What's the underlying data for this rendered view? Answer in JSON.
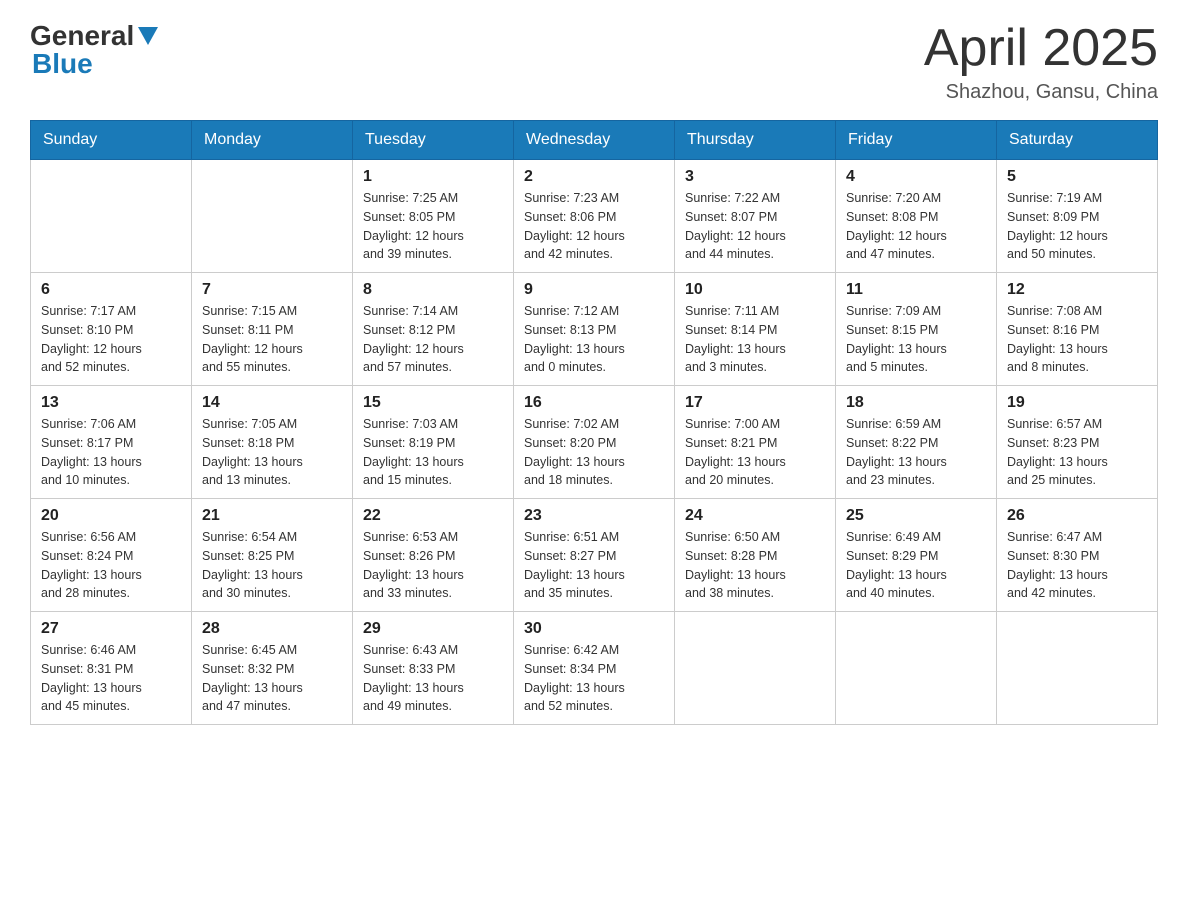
{
  "logo": {
    "general": "General",
    "blue": "Blue",
    "arrow_color": "#1a7ab8"
  },
  "header": {
    "title": "April 2025",
    "location": "Shazhou, Gansu, China"
  },
  "days_of_week": [
    "Sunday",
    "Monday",
    "Tuesday",
    "Wednesday",
    "Thursday",
    "Friday",
    "Saturday"
  ],
  "weeks": [
    [
      {
        "num": "",
        "info": ""
      },
      {
        "num": "",
        "info": ""
      },
      {
        "num": "1",
        "info": "Sunrise: 7:25 AM\nSunset: 8:05 PM\nDaylight: 12 hours\nand 39 minutes."
      },
      {
        "num": "2",
        "info": "Sunrise: 7:23 AM\nSunset: 8:06 PM\nDaylight: 12 hours\nand 42 minutes."
      },
      {
        "num": "3",
        "info": "Sunrise: 7:22 AM\nSunset: 8:07 PM\nDaylight: 12 hours\nand 44 minutes."
      },
      {
        "num": "4",
        "info": "Sunrise: 7:20 AM\nSunset: 8:08 PM\nDaylight: 12 hours\nand 47 minutes."
      },
      {
        "num": "5",
        "info": "Sunrise: 7:19 AM\nSunset: 8:09 PM\nDaylight: 12 hours\nand 50 minutes."
      }
    ],
    [
      {
        "num": "6",
        "info": "Sunrise: 7:17 AM\nSunset: 8:10 PM\nDaylight: 12 hours\nand 52 minutes."
      },
      {
        "num": "7",
        "info": "Sunrise: 7:15 AM\nSunset: 8:11 PM\nDaylight: 12 hours\nand 55 minutes."
      },
      {
        "num": "8",
        "info": "Sunrise: 7:14 AM\nSunset: 8:12 PM\nDaylight: 12 hours\nand 57 minutes."
      },
      {
        "num": "9",
        "info": "Sunrise: 7:12 AM\nSunset: 8:13 PM\nDaylight: 13 hours\nand 0 minutes."
      },
      {
        "num": "10",
        "info": "Sunrise: 7:11 AM\nSunset: 8:14 PM\nDaylight: 13 hours\nand 3 minutes."
      },
      {
        "num": "11",
        "info": "Sunrise: 7:09 AM\nSunset: 8:15 PM\nDaylight: 13 hours\nand 5 minutes."
      },
      {
        "num": "12",
        "info": "Sunrise: 7:08 AM\nSunset: 8:16 PM\nDaylight: 13 hours\nand 8 minutes."
      }
    ],
    [
      {
        "num": "13",
        "info": "Sunrise: 7:06 AM\nSunset: 8:17 PM\nDaylight: 13 hours\nand 10 minutes."
      },
      {
        "num": "14",
        "info": "Sunrise: 7:05 AM\nSunset: 8:18 PM\nDaylight: 13 hours\nand 13 minutes."
      },
      {
        "num": "15",
        "info": "Sunrise: 7:03 AM\nSunset: 8:19 PM\nDaylight: 13 hours\nand 15 minutes."
      },
      {
        "num": "16",
        "info": "Sunrise: 7:02 AM\nSunset: 8:20 PM\nDaylight: 13 hours\nand 18 minutes."
      },
      {
        "num": "17",
        "info": "Sunrise: 7:00 AM\nSunset: 8:21 PM\nDaylight: 13 hours\nand 20 minutes."
      },
      {
        "num": "18",
        "info": "Sunrise: 6:59 AM\nSunset: 8:22 PM\nDaylight: 13 hours\nand 23 minutes."
      },
      {
        "num": "19",
        "info": "Sunrise: 6:57 AM\nSunset: 8:23 PM\nDaylight: 13 hours\nand 25 minutes."
      }
    ],
    [
      {
        "num": "20",
        "info": "Sunrise: 6:56 AM\nSunset: 8:24 PM\nDaylight: 13 hours\nand 28 minutes."
      },
      {
        "num": "21",
        "info": "Sunrise: 6:54 AM\nSunset: 8:25 PM\nDaylight: 13 hours\nand 30 minutes."
      },
      {
        "num": "22",
        "info": "Sunrise: 6:53 AM\nSunset: 8:26 PM\nDaylight: 13 hours\nand 33 minutes."
      },
      {
        "num": "23",
        "info": "Sunrise: 6:51 AM\nSunset: 8:27 PM\nDaylight: 13 hours\nand 35 minutes."
      },
      {
        "num": "24",
        "info": "Sunrise: 6:50 AM\nSunset: 8:28 PM\nDaylight: 13 hours\nand 38 minutes."
      },
      {
        "num": "25",
        "info": "Sunrise: 6:49 AM\nSunset: 8:29 PM\nDaylight: 13 hours\nand 40 minutes."
      },
      {
        "num": "26",
        "info": "Sunrise: 6:47 AM\nSunset: 8:30 PM\nDaylight: 13 hours\nand 42 minutes."
      }
    ],
    [
      {
        "num": "27",
        "info": "Sunrise: 6:46 AM\nSunset: 8:31 PM\nDaylight: 13 hours\nand 45 minutes."
      },
      {
        "num": "28",
        "info": "Sunrise: 6:45 AM\nSunset: 8:32 PM\nDaylight: 13 hours\nand 47 minutes."
      },
      {
        "num": "29",
        "info": "Sunrise: 6:43 AM\nSunset: 8:33 PM\nDaylight: 13 hours\nand 49 minutes."
      },
      {
        "num": "30",
        "info": "Sunrise: 6:42 AM\nSunset: 8:34 PM\nDaylight: 13 hours\nand 52 minutes."
      },
      {
        "num": "",
        "info": ""
      },
      {
        "num": "",
        "info": ""
      },
      {
        "num": "",
        "info": ""
      }
    ]
  ]
}
